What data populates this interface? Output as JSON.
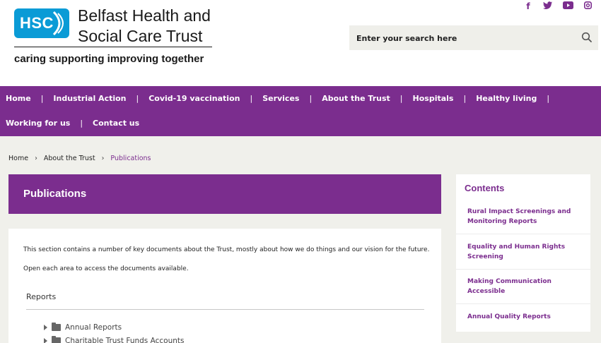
{
  "header": {
    "org_name_line1": "Belfast Health and",
    "org_name_line2": "Social Care Trust",
    "logo_badge": "HSC",
    "tagline": "caring supporting improving together",
    "social_icons": [
      "facebook-icon",
      "twitter-icon",
      "youtube-icon",
      "instagram-icon"
    ]
  },
  "search": {
    "placeholder": "Enter your search here",
    "icon": "search-icon"
  },
  "nav": {
    "row1": [
      "Home",
      "Industrial Action",
      "Covid-19 vaccination",
      "Services",
      "About the Trust",
      "Hospitals",
      "Healthy living"
    ],
    "row2": [
      "Working for us",
      "Contact us"
    ],
    "separator": "|"
  },
  "breadcrumb": {
    "items": [
      "Home",
      "About the Trust",
      "Publications"
    ],
    "separator": "›"
  },
  "page": {
    "title": "Publications",
    "intro": "This section contains a number of key documents about the Trust, mostly about how we do things and our vision for the future.",
    "instruction": "Open each area to access the documents available.",
    "section_heading": "Reports",
    "tree": [
      "Annual Reports",
      "Charitable Trust Funds Accounts"
    ]
  },
  "sidebar": {
    "heading": "Contents",
    "links": [
      "Rural Impact Screenings and Monitoring Reports",
      "Equality and Human Rights Screening",
      "Making Communication Accessible",
      "Annual Quality Reports"
    ]
  },
  "colors": {
    "brand_purple": "#7b2d8e",
    "hsc_blue": "#0a9bd6",
    "page_bg": "#f0f0eb"
  }
}
